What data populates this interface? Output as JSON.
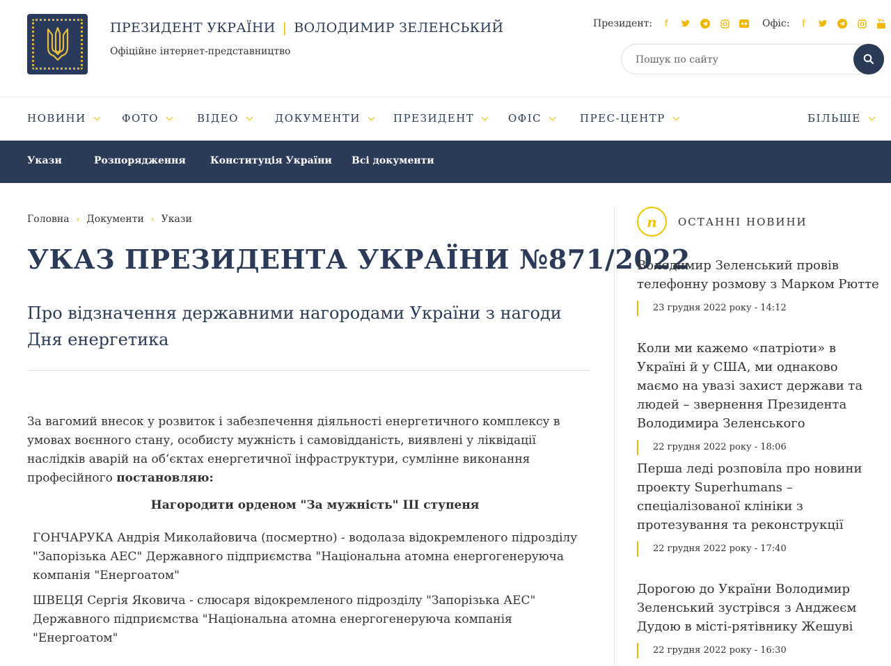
{
  "header": {
    "title_left": "ПРЕЗИДЕНТ УКРАЇНИ",
    "title_right": "ВОЛОДИМИР ЗЕЛЕНСЬКИЙ",
    "subtitle": "Офіційне інтернет-представництво",
    "social_president_label": "Президент:",
    "social_office_label": "Офіс:",
    "search_placeholder": "Пошук по сайту",
    "accent_color": "#f2b700",
    "brand_color": "#2b3a57"
  },
  "nav": {
    "items": [
      "НОВИНИ",
      "ФОТО",
      "ВІДЕО",
      "ДОКУМЕНТИ",
      "ПРЕЗИДЕНТ",
      "ОФІС",
      "ПРЕС-ЦЕНТР",
      "БІЛЬШЕ"
    ]
  },
  "subnav": {
    "items": [
      "Укази",
      "Розпорядження",
      "Конституція України",
      "Всі документи"
    ]
  },
  "breadcrumb": [
    "Головна",
    "Документи",
    "Укази"
  ],
  "article": {
    "title": "УКАЗ ПРЕЗИДЕНТА УКРАЇНИ №871/2022",
    "subtitle": "Про відзначення державними нагородами України з нагоди Дня енергетика",
    "intro": "За вагомий внесок у розвиток і забезпечення діяльності енергетичного комплексу в умовах воєнного стану, особисту мужність і самовідданість, виявлені у ліквідації наслідків аварій на об’єктах енергетичної інфраструктури, сумлінне виконання професійного",
    "intro_bold": "постановляю:",
    "award_heading": "Нагородити орденом \"За мужність\" III ступеня",
    "persons": [
      "ГОНЧАРУКА Андрія Миколайовича (посмертно) - водолаза відокремленого підрозділу \"Запорізька АЕС\" Державного підприємства \"Національна атомна енергогенеруюча компанія \"Енергоатом\"",
      "ШВЕЦЯ Сергія Яковича - слюсаря відокремленого підрозділу \"Запорізька АЕС\" Державного підприємства \"Національна атомна енергогенеруюча компанія \"Енергоатом\""
    ]
  },
  "sidebar": {
    "heading": "ОСТАННІ НОВИНИ",
    "news": [
      {
        "text": "Володимир Зеленський провів телефонну розмову з Марком Рютте",
        "date": "23 грудня 2022 року - 14:12"
      },
      {
        "text": "Коли ми кажемо «патріоти» в Україні й у США, ми однаково маємо на увазі захист держави та людей – звернення Президента Володимира Зеленського",
        "date": "22 грудня 2022 року - 18:06"
      },
      {
        "text": "Перша леді розповіла про новини проекту Superhumans – спеціалізованої клініки з протезування та реконструкції",
        "date": "22 грудня 2022 року - 17:40"
      },
      {
        "text": "Дорогою до України Володимир Зеленський зустрівся з Анджеєм Дудою в місті-рятівнику Жешуві",
        "date": "22 грудня 2022 року - 16:30"
      }
    ]
  }
}
